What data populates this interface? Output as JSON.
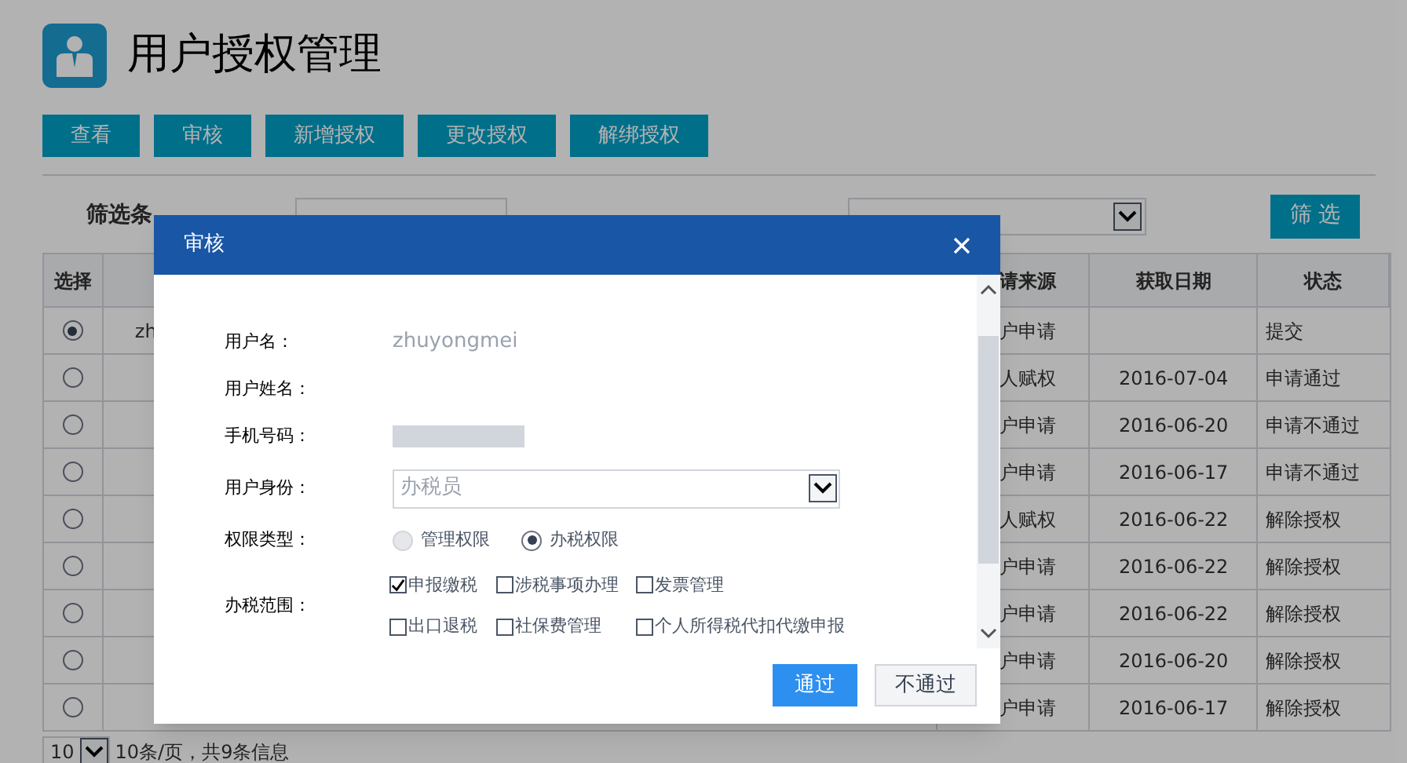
{
  "page": {
    "title": "用户授权管理"
  },
  "toolbar": [
    "查看",
    "审核",
    "新增授权",
    "更改授权",
    "解绑授权"
  ],
  "filter": {
    "heading": "筛选条",
    "button": "筛 选"
  },
  "table": {
    "columns": [
      "选择",
      "",
      "请来源",
      "获取日期",
      "状态"
    ],
    "rows": [
      {
        "selected": true,
        "column_2": "zh",
        "source": "户申请",
        "date": "",
        "status": "提交"
      },
      {
        "selected": false,
        "column_2": "",
        "source": "人赋权",
        "date": "2016-07-04",
        "status": "申请通过"
      },
      {
        "selected": false,
        "column_2": "",
        "source": "户申请",
        "date": "2016-06-20",
        "status": "申请不通过"
      },
      {
        "selected": false,
        "column_2": "",
        "source": "户申请",
        "date": "2016-06-17",
        "status": "申请不通过"
      },
      {
        "selected": false,
        "column_2": "",
        "source": "人赋权",
        "date": "2016-06-22",
        "status": "解除授权"
      },
      {
        "selected": false,
        "column_2": "",
        "source": "户申请",
        "date": "2016-06-22",
        "status": "解除授权"
      },
      {
        "selected": false,
        "column_2": "",
        "source": "户申请",
        "date": "2016-06-22",
        "status": "解除授权"
      },
      {
        "selected": false,
        "column_2": "",
        "source": "户申请",
        "date": "2016-06-20",
        "status": "解除授权"
      },
      {
        "selected": false,
        "column_2": "",
        "source": "户申请",
        "date": "2016-06-17",
        "status": "解除授权"
      }
    ]
  },
  "pagination": {
    "page_size": "10",
    "summary": "10条/页，共9条信息"
  },
  "dialog": {
    "title": "审核",
    "fields": [
      {
        "kind": "text",
        "label": "用户名：",
        "value": "zhuyongmei"
      },
      {
        "kind": "text",
        "label": "用户姓名："
      },
      {
        "kind": "redacted",
        "label": "手机号码："
      },
      {
        "kind": "select",
        "label": "用户身份：",
        "value": "办税员"
      },
      {
        "kind": "radio",
        "label": "权限类型：",
        "options": [
          {
            "label": "管理权限",
            "selected": false
          },
          {
            "label": "办税权限",
            "selected": true
          }
        ]
      },
      {
        "kind": "checks",
        "label": "办税范围：",
        "options": [
          {
            "label": "申报缴税",
            "checked": true
          },
          {
            "label": "涉税事项办理",
            "checked": false
          },
          {
            "label": "发票管理",
            "checked": false
          },
          {
            "label": "出口退税",
            "checked": false
          },
          {
            "label": "社保费管理",
            "checked": false
          },
          {
            "label": "个人所得税代扣代缴申报",
            "checked": false
          }
        ]
      }
    ],
    "buttons": [
      {
        "label": "通过",
        "kind": "primary"
      },
      {
        "label": "不通过",
        "kind": "secondary"
      }
    ]
  }
}
